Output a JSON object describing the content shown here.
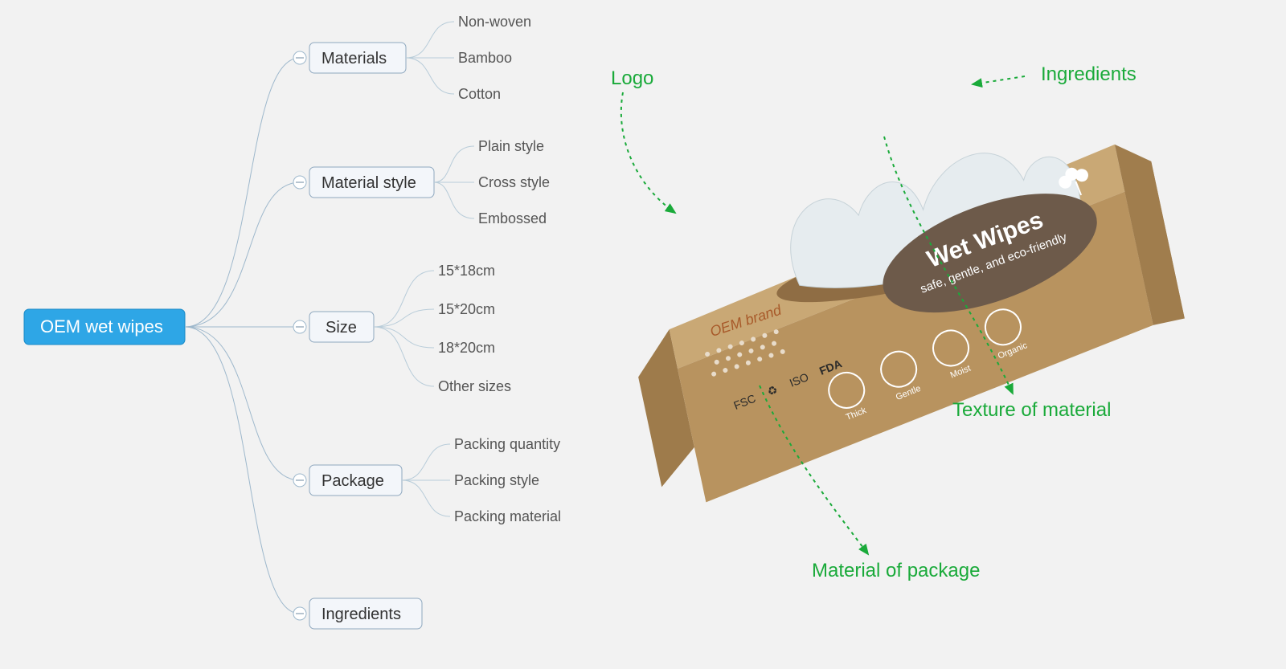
{
  "mindmap": {
    "root": "OEM wet wipes",
    "branches": [
      {
        "label": "Materials",
        "children": [
          "Non-woven",
          "Bamboo",
          "Cotton"
        ]
      },
      {
        "label": "Material style",
        "children": [
          "Plain style",
          "Cross style",
          "Embossed"
        ]
      },
      {
        "label": "Size",
        "children": [
          "15*18cm",
          "15*20cm",
          "18*20cm",
          "Other sizes"
        ]
      },
      {
        "label": "Package",
        "children": [
          "Packing quantity",
          "Packing style",
          "Packing material"
        ]
      },
      {
        "label": "Ingredients",
        "children": []
      }
    ]
  },
  "callouts": {
    "logo": "Logo",
    "ingredients": "Ingredients",
    "texture": "Texture of material",
    "material_pkg": "Material of package"
  },
  "product": {
    "brand": "OEM brand",
    "title": "Wet Wipes",
    "subtitle": "safe, gentle, and eco-friendly",
    "certs": [
      "FSC",
      "♻",
      "ISO",
      "FDA"
    ],
    "badges": [
      "Thick",
      "Gentle",
      "Moist",
      "Organic"
    ]
  }
}
